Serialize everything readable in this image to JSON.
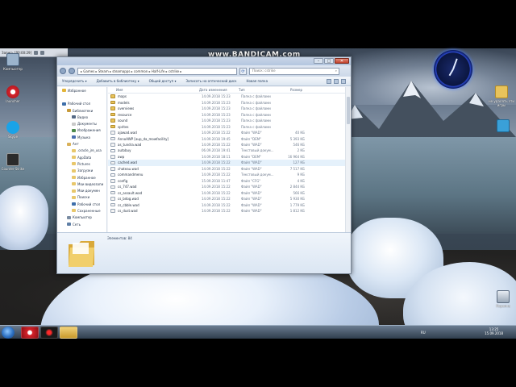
{
  "recorder": {
    "label": "Запись [00:00:29]"
  },
  "watermark": {
    "text": "www.BANDICAM.com"
  },
  "desktop_icons": {
    "computer": "Компьютер",
    "opera": "launcher",
    "skype": "Skype",
    "cs": "Counter-Strike",
    "folder_right": "не удалять эти игры",
    "trash": "Корзина"
  },
  "explorer": {
    "address": "▸ Games ▸ Steam ▸ steamapps ▸ common ▸ Half-Life ▸ cstrike ▸",
    "search_placeholder": "Поиск: cstrike",
    "toolbar": {
      "organize": "Упорядочить ▾",
      "add_to_library": "Добавить в библиотеку ▾",
      "share": "Общий доступ ▾",
      "burn": "Записать на оптический диск",
      "new_folder": "Новая папка"
    },
    "sidebar": [
      {
        "label": "Избранное",
        "indent": 0,
        "color": "#e3b53a"
      },
      {
        "label": "",
        "indent": 0,
        "color": "transparent"
      },
      {
        "label": "Рабочий стол",
        "indent": 0,
        "color": "#3d6eaa"
      },
      {
        "label": "Библиотеки",
        "indent": 1,
        "color": "#c79a3a"
      },
      {
        "label": "Видео",
        "indent": 2,
        "color": "#556a86"
      },
      {
        "label": "Документы",
        "indent": 2,
        "color": "#c9c9c9"
      },
      {
        "label": "Изображения",
        "indent": 2,
        "color": "#4d8a4d"
      },
      {
        "label": "Музыка",
        "indent": 2,
        "color": "#4a6fb0"
      },
      {
        "label": "Ант",
        "indent": 1,
        "color": "#d9b15a"
      },
      {
        "label": ".oracle_jre_usa",
        "indent": 2,
        "color": "#e8c76b"
      },
      {
        "label": "AppData",
        "indent": 2,
        "color": "#e8c76b"
      },
      {
        "label": "Pictures",
        "indent": 2,
        "color": "#e8c76b"
      },
      {
        "label": "Загрузки",
        "indent": 2,
        "color": "#e8c76b"
      },
      {
        "label": "Избранное",
        "indent": 2,
        "color": "#e8c76b"
      },
      {
        "label": "Мои видеозапи",
        "indent": 2,
        "color": "#e8c76b"
      },
      {
        "label": "Мои докумен",
        "indent": 2,
        "color": "#e8c76b"
      },
      {
        "label": "Поиски",
        "indent": 2,
        "color": "#e8c76b"
      },
      {
        "label": "Рабочий стол",
        "indent": 2,
        "color": "#3d6eaa"
      },
      {
        "label": "Сохраненные",
        "indent": 2,
        "color": "#e8c76b"
      },
      {
        "label": "Компьютер",
        "indent": 1,
        "color": "#7a8ca3"
      },
      {
        "label": "Сеть",
        "indent": 1,
        "color": "#5f7fa6"
      }
    ],
    "columns": {
      "name": "Имя",
      "date": "Дата изменения",
      "type": "Тип",
      "size": "Размер"
    },
    "files": [
      {
        "name": "maps",
        "date": "14.09.2018 15:23",
        "type": "Папка с файлами",
        "size": "",
        "kind": "folder"
      },
      {
        "name": "models",
        "date": "14.09.2018 15:23",
        "type": "Папка с файлами",
        "size": "",
        "kind": "folder"
      },
      {
        "name": "overviews",
        "date": "14.09.2018 15:23",
        "type": "Папка с файлами",
        "size": "",
        "kind": "folder"
      },
      {
        "name": "resource",
        "date": "14.09.2018 15:23",
        "type": "Папка с файлами",
        "size": "",
        "kind": "folder"
      },
      {
        "name": "sound",
        "date": "14.09.2018 15:23",
        "type": "Папка с файлами",
        "size": "",
        "kind": "folder"
      },
      {
        "name": "sprites",
        "date": "14.09.2018 15:23",
        "type": "Папка с файлами",
        "size": "",
        "kind": "folder"
      },
      {
        "name": "ajawad.wad",
        "date": "14.09.2018 15:22",
        "type": "Файл \"WAD\"",
        "size": "40 КБ",
        "kind": "file"
      },
      {
        "name": "AnnoAWP [aup_da_mowfacility]",
        "date": "14.09.2018 19:45",
        "type": "Файл \"DEM\"",
        "size": "5 393 КБ",
        "kind": "file"
      },
      {
        "name": "as_tundra.wad",
        "date": "14.09.2018 15:22",
        "type": "Файл \"WAD\"",
        "size": "546 КБ",
        "kind": "file"
      },
      {
        "name": "autobuy",
        "date": "06.09.2018 19:41",
        "type": "Текстовый докум...",
        "size": "2 КБ",
        "kind": "text"
      },
      {
        "name": "awp",
        "date": "14.09.2018 18:11",
        "type": "Файл \"DEM\"",
        "size": "16 964 КБ",
        "kind": "file"
      },
      {
        "name": "cached.wad",
        "date": "14.09.2018 15:22",
        "type": "Файл \"WAD\"",
        "size": "127 КБ",
        "kind": "file"
      },
      {
        "name": "chateau.wad",
        "date": "14.09.2018 15:22",
        "type": "Файл \"WAD\"",
        "size": "7 517 КБ",
        "kind": "file"
      },
      {
        "name": "commandmenu",
        "date": "14.09.2018 15:22",
        "type": "Текстовый докум...",
        "size": "9 КБ",
        "kind": "text"
      },
      {
        "name": "config",
        "date": "15.09.2018 11:47",
        "type": "Файл \"CFG\"",
        "size": "4 КБ",
        "kind": "file"
      },
      {
        "name": "cs_747.wad",
        "date": "14.09.2018 15:22",
        "type": "Файл \"WAD\"",
        "size": "2 844 КБ",
        "kind": "file"
      },
      {
        "name": "cs_assault.wad",
        "date": "14.09.2018 15:22",
        "type": "Файл \"WAD\"",
        "size": "566 КБ",
        "kind": "file"
      },
      {
        "name": "cs_bdog.wad",
        "date": "14.09.2018 15:22",
        "type": "Файл \"WAD\"",
        "size": "5 930 КБ",
        "kind": "file"
      },
      {
        "name": "cs_cbble.wad",
        "date": "14.09.2018 15:22",
        "type": "Файл \"WAD\"",
        "size": "1 779 КБ",
        "kind": "file"
      },
      {
        "name": "cs_dust.wad",
        "date": "14.09.2018 15:22",
        "type": "Файл \"WAD\"",
        "size": "1 812 КБ",
        "kind": "file"
      }
    ],
    "status": "Элементов: 84"
  },
  "taskbar": {
    "lang": "RU",
    "time": "13:25",
    "date": "15.09.2018"
  },
  "colors": {
    "folder": "#e8c35b",
    "file": "#f3f3f3",
    "text_file": "#ffffff",
    "accent": "#2c6fc0"
  }
}
